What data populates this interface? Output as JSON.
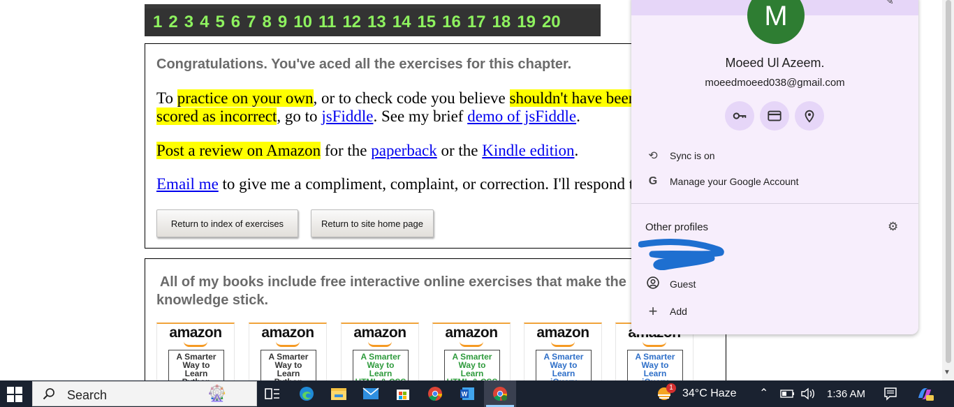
{
  "number_bar": [
    "1",
    "2",
    "3",
    "4",
    "5",
    "6",
    "7",
    "8",
    "9",
    "10",
    "11",
    "12",
    "13",
    "14",
    "15",
    "16",
    "17",
    "18",
    "19",
    "20"
  ],
  "main": {
    "congrats": "Congratulations. You've aced all the exercises for this chapter.",
    "para1": {
      "t1": "To ",
      "hl1": "practice on your own",
      "t2": ", or to check code you believe ",
      "hl2": "shouldn't have been",
      "hl3": "scored as incorrect",
      "t3": ", go to ",
      "link1": "jsFiddle",
      "t4": ". See my brief ",
      "link2": "demo of jsFiddle",
      "t5": "."
    },
    "para2": {
      "hl": "Post a review on Amazon",
      "t1": " for the ",
      "link1": "paperback",
      "t2": " or the ",
      "link2": "Kindle edition",
      "t3": "."
    },
    "para3": {
      "link": "Email me",
      "t1": " to give me a compliment, complaint, or correction. I'll respond the same day."
    },
    "buttons": {
      "index": "Return to index of exercises",
      "home": "Return to site home page"
    }
  },
  "books": {
    "title_line1": " All of my books include free interactive online exercises that make the",
    "title_line2": "knowledge stick.",
    "brand": "amazon",
    "items": [
      {
        "line1": "A Smarter",
        "line2": "Way to",
        "line3": "Learn",
        "line4": "Python",
        "color": "#333333"
      },
      {
        "line1": "A Smarter",
        "line2": "Way to",
        "line3": "Learn",
        "line4": "Python",
        "color": "#333333"
      },
      {
        "line1": "A Smarter",
        "line2": "Way to",
        "line3": "Learn",
        "line4": "HTML & CSS",
        "color": "#2e9a3c"
      },
      {
        "line1": "A Smarter",
        "line2": "Way to",
        "line3": "Learn",
        "line4": "HTML & CSS",
        "color": "#2e9a3c"
      },
      {
        "line1": "A Smarter",
        "line2": "Way to",
        "line3": "Learn",
        "line4": "jQuery",
        "color": "#2e6fc8"
      },
      {
        "line1": "A Smarter",
        "line2": "Way to",
        "line3": "Learn",
        "line4": "jQuery",
        "color": "#2e6fc8"
      }
    ]
  },
  "profile": {
    "avatar_letter": "M",
    "avatar_color": "#2e7d32",
    "name": "Moeed Ul Azeem.",
    "email": "moeedmoeed038@gmail.com",
    "quick_icons": [
      "key-icon",
      "credit-card-icon",
      "location-pin-icon"
    ],
    "sync": "Sync is on",
    "manage": "Manage your Google Account",
    "other_profiles": "Other profiles",
    "guest": "Guest",
    "add": "Add"
  },
  "taskbar": {
    "search_placeholder": "Search",
    "weather": "34°C  Haze",
    "notification_count": "1",
    "time": "1:36 AM",
    "apps": [
      "task-view-icon",
      "edge-icon",
      "file-explorer-icon",
      "mail-icon",
      "store-icon",
      "chrome-icon",
      "word-icon",
      "chrome-profile-icon"
    ]
  }
}
